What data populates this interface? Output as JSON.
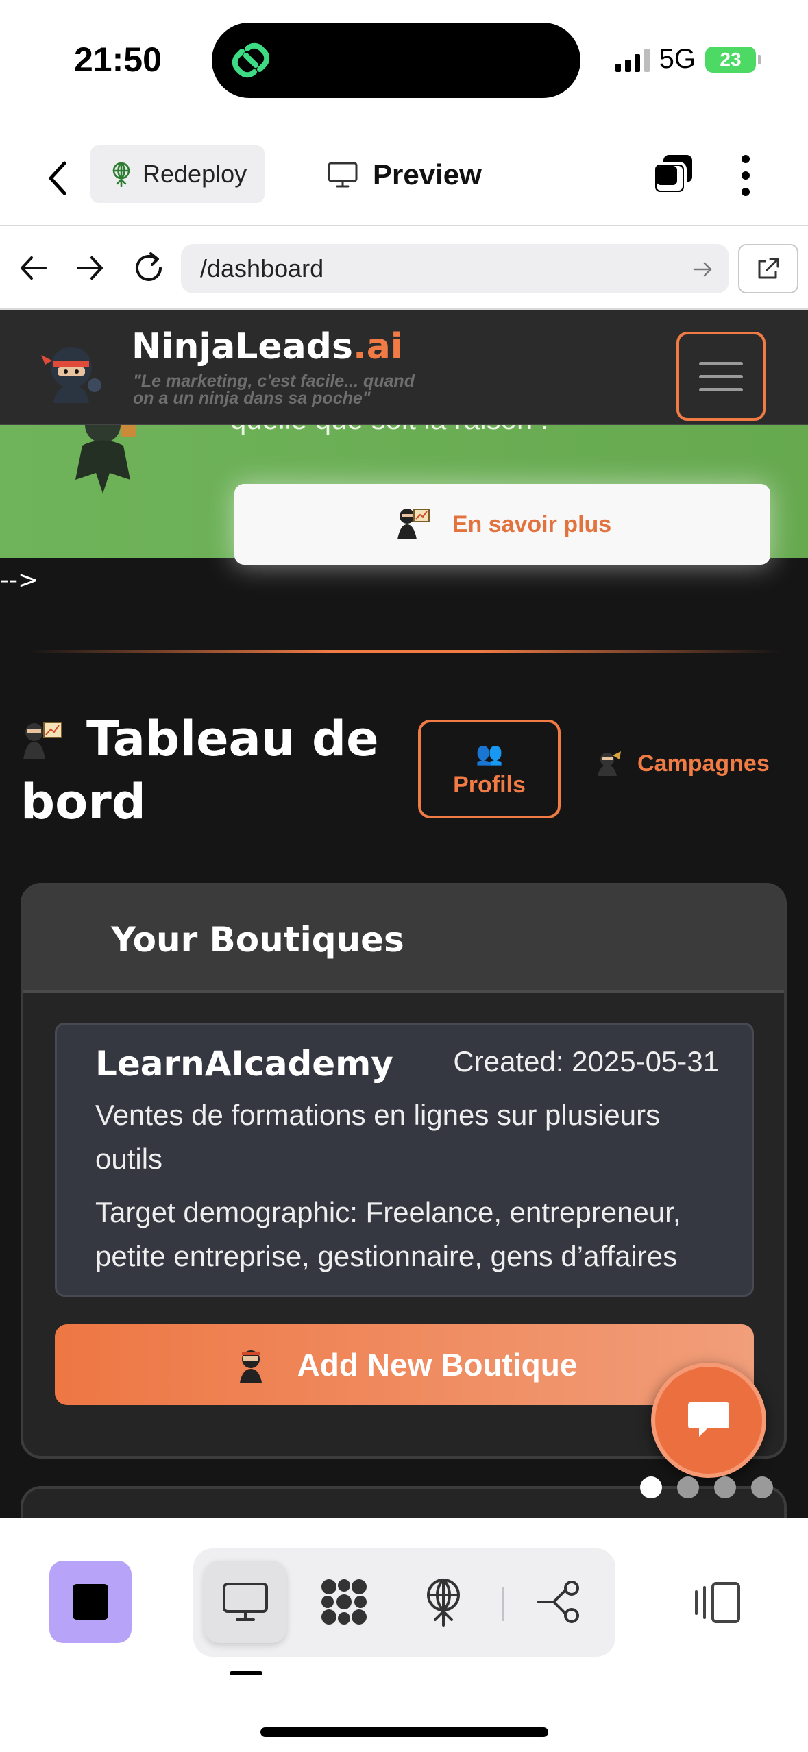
{
  "status_bar": {
    "time": "21:50",
    "network": "5G",
    "battery": "23",
    "island_icon": "link-app-icon",
    "island_color": "#3ddc84"
  },
  "app_toolbar": {
    "back_icon": "chevron-left-icon",
    "redeploy_label": "Redeploy",
    "preview_label": "Preview",
    "tabs_icon": "tabs-icon",
    "more_icon": "more-vertical-icon"
  },
  "browser": {
    "url": "/dashboard"
  },
  "site": {
    "brand_main": "NinjaLeads",
    "brand_suffix": ".ai",
    "tagline": "\"Le marketing, c'est facile... quand on a un ninja dans sa poche\"",
    "promo_text": "quelle que soit la raison !",
    "promo_button": "En savoir plus",
    "stray_text": "-->",
    "dashboard_title": "Tableau de bord",
    "nav": {
      "profils_icon": "👥",
      "profils": "Profils",
      "campagnes": "Campagnes"
    },
    "boutiques_card": {
      "title": "Your Boutiques",
      "items": [
        {
          "name": "LearnAIcademy",
          "created": "Created: 2025-05-31",
          "description": "Ventes de formations en lignes sur plusieurs outils",
          "target": "Target demographic: Freelance, entrepreneur, petite entreprise, gestionnaire, gens d’affaires"
        }
      ],
      "add_button": "Add New Boutique"
    },
    "colors": {
      "accent": "#f07b45",
      "background": "#151515",
      "promo_green": "#6fb35a"
    }
  },
  "page_dots": {
    "count": 4,
    "active_index": 0
  },
  "bottom_dock": {
    "stop_icon": "stop-icon",
    "segments": [
      "monitor-icon",
      "modules-icon",
      "deploy-icon",
      "workflow-icon"
    ],
    "active_segment": 0,
    "panel_icon": "panel-toggle-icon"
  }
}
